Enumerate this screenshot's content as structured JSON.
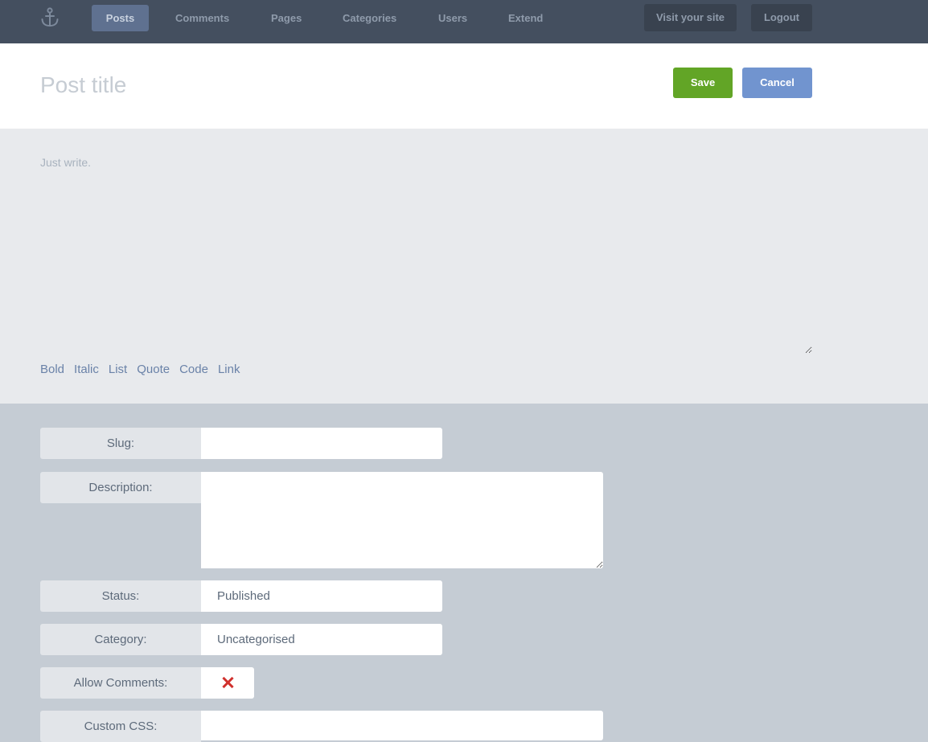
{
  "nav": {
    "logo_icon": "anchor-icon",
    "items": [
      {
        "label": "Posts",
        "active": true
      },
      {
        "label": "Comments"
      },
      {
        "label": "Pages"
      },
      {
        "label": "Categories"
      },
      {
        "label": "Users"
      },
      {
        "label": "Extend"
      }
    ],
    "visit_site": "Visit your site",
    "logout": "Logout"
  },
  "header": {
    "title_placeholder": "Post title",
    "save_label": "Save",
    "cancel_label": "Cancel"
  },
  "editor": {
    "placeholder": "Just write.",
    "toolbar": [
      "Bold",
      "Italic",
      "List",
      "Quote",
      "Code",
      "Link"
    ]
  },
  "meta": {
    "slug": {
      "label": "Slug:",
      "value": ""
    },
    "description": {
      "label": "Description:",
      "value": ""
    },
    "status": {
      "label": "Status:",
      "value": "Published"
    },
    "category": {
      "label": "Category:",
      "value": "Uncategorised"
    },
    "allow_comments": {
      "label": "Allow Comments:",
      "checked": false,
      "icon": "x-mark-icon"
    },
    "custom_css": {
      "label": "Custom CSS:",
      "value": ""
    }
  },
  "colors": {
    "nav_bg": "#444f5f",
    "nav_active": "#5f7190",
    "save": "#62a526",
    "cancel": "#7194cf",
    "unchecked_mark": "#d0312d"
  }
}
